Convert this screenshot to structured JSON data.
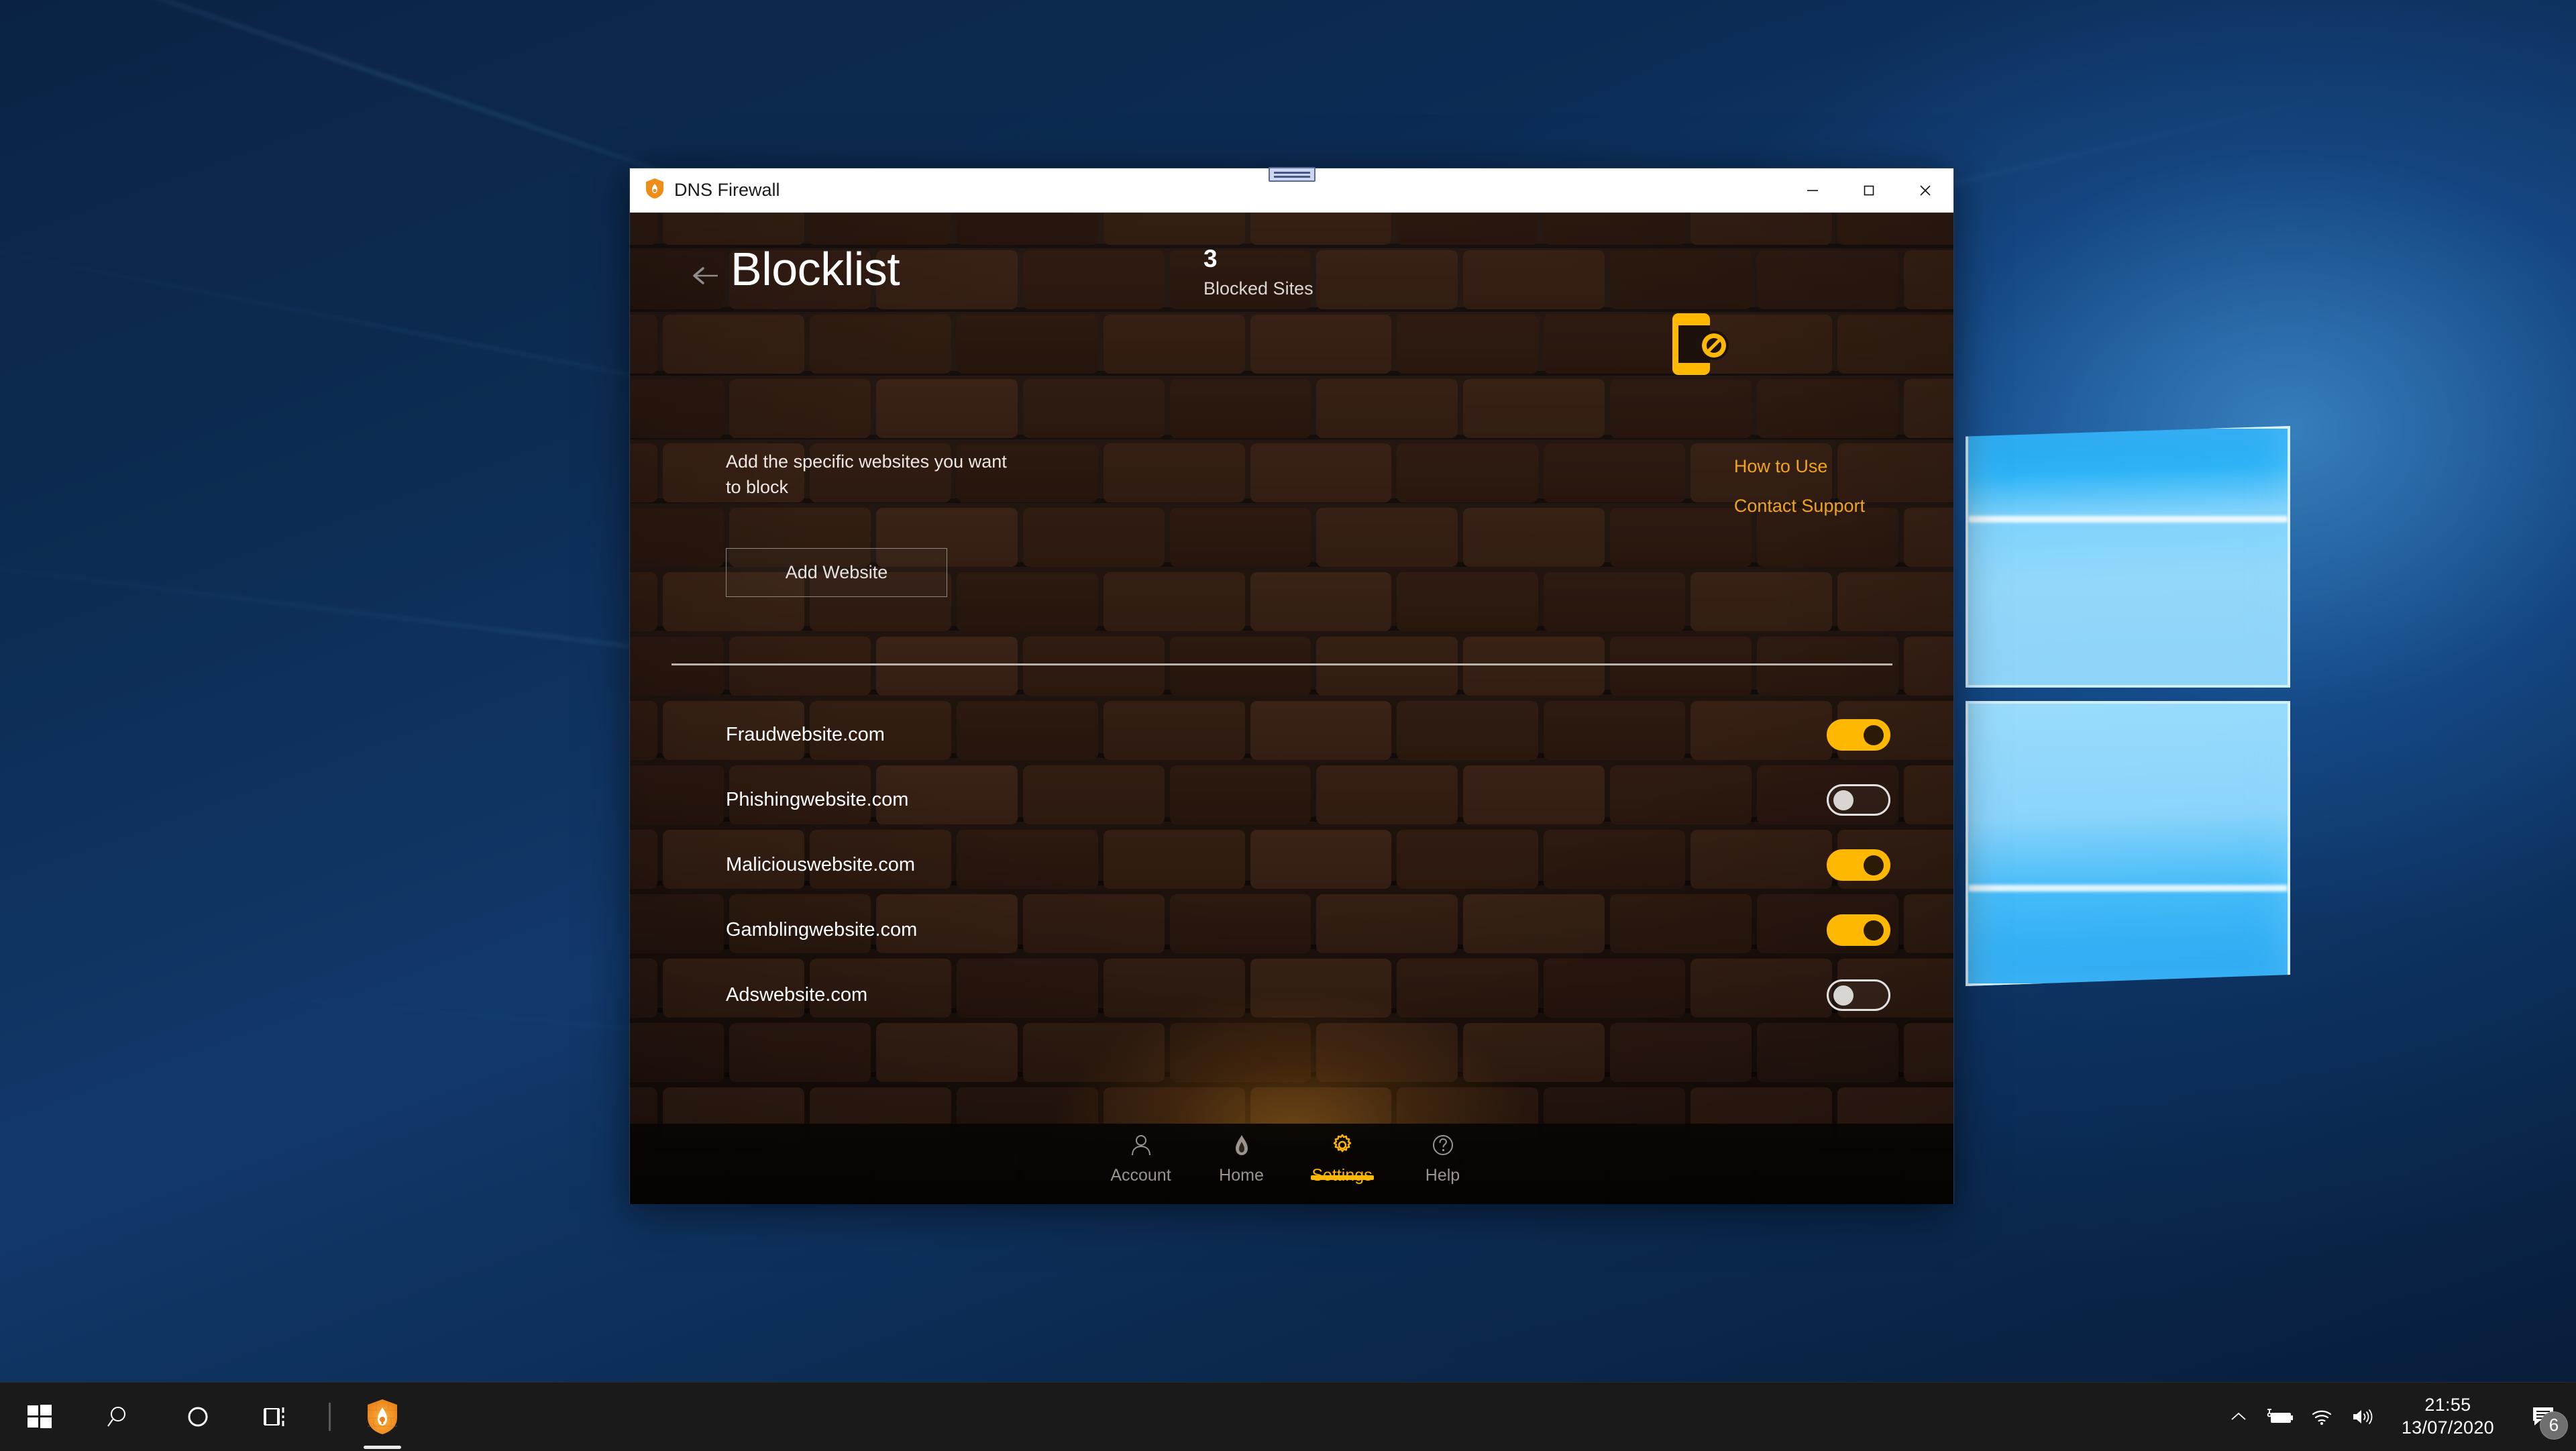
{
  "desktop": {
    "wallpaper_name": "windows-10-hero-wallpaper",
    "accent_blue": "#1fa2f0"
  },
  "taskbar": {
    "start_button": "start-button",
    "search_icon": "search-icon",
    "cortana_icon": "cortana-circle-icon",
    "task_view_icon": "task-view-icon",
    "pinned_app": "dns-firewall-shield-icon",
    "tray": {
      "show_hidden_icons": "chevron-up-icon",
      "battery_icon": "battery-charging-icon",
      "network_icon": "wifi-icon",
      "volume_icon": "speaker-icon"
    },
    "clock": {
      "time": "21:55",
      "date": "13/07/2020"
    },
    "action_center": {
      "icon": "action-center-icon",
      "badge_count": "6"
    }
  },
  "window": {
    "title": "DNS Firewall",
    "app_icon": "shield-flame-icon",
    "snap_handle": "window-snap-handle",
    "controls": {
      "minimize": "minimize-icon",
      "maximize": "maximize-icon",
      "close": "close-icon"
    }
  },
  "page": {
    "back_icon": "back-arrow-icon",
    "title": "Blocklist",
    "stat": {
      "value": "3",
      "label": "Blocked Sites"
    },
    "hero_icon": "phone-blocked-icon",
    "description": "Add the specific websites you want to block",
    "add_button": "Add Website",
    "links": [
      {
        "label": "How to Use",
        "name": "how-to-use-link"
      },
      {
        "label": "Contact Support",
        "name": "contact-support-link"
      }
    ],
    "accent_color": "#ffb800",
    "link_color": "#f0a41b"
  },
  "sites": [
    {
      "name": "Fraudwebsite.com",
      "blocked": true
    },
    {
      "name": "Phishingwebsite.com",
      "blocked": false
    },
    {
      "name": "Maliciouswebsite.com",
      "blocked": true
    },
    {
      "name": "Gamblingwebsite.com",
      "blocked": true
    },
    {
      "name": "Adswebsite.com",
      "blocked": false
    }
  ],
  "nav": [
    {
      "label": "Account",
      "icon": "person-icon",
      "active": false
    },
    {
      "label": "Home",
      "icon": "flame-icon",
      "active": false
    },
    {
      "label": "Settings",
      "icon": "gear-icon",
      "active": true
    },
    {
      "label": "Help",
      "icon": "question-circle-icon",
      "active": false
    }
  ]
}
